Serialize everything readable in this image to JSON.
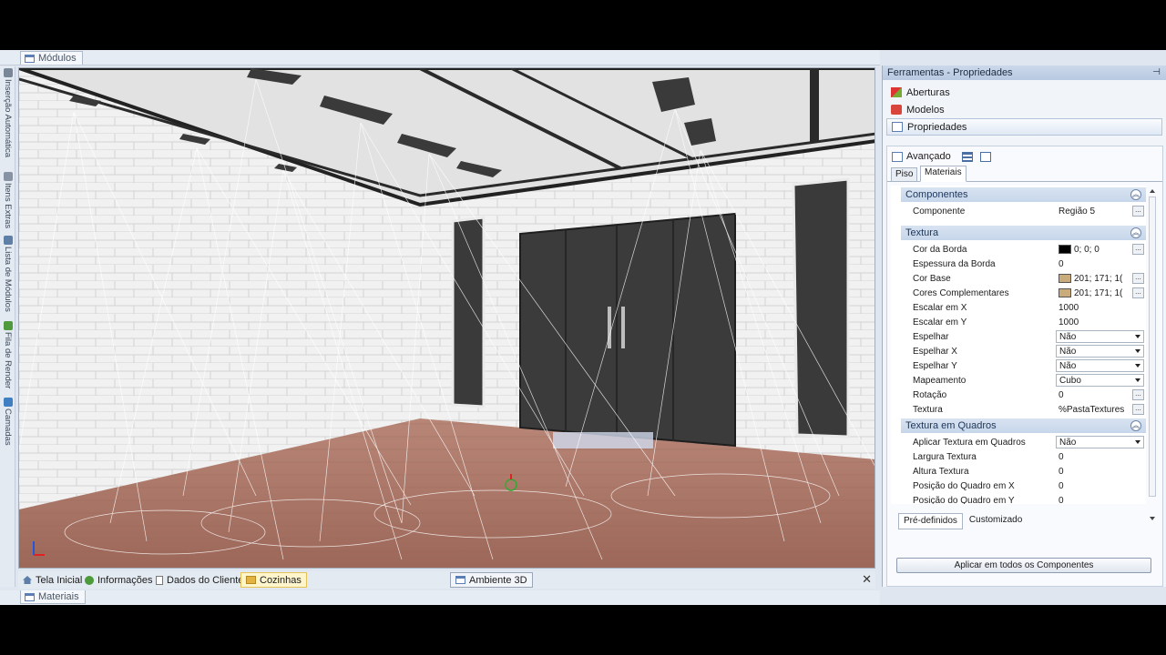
{
  "top_tab": {
    "label": "Módulos"
  },
  "bottom_tab": {
    "label": "Materiais"
  },
  "left_tabs": [
    {
      "label": "Inserção Automática"
    },
    {
      "label": "Itens Extras"
    },
    {
      "label": "Lista de Módulos"
    },
    {
      "label": "Fila de Render"
    },
    {
      "label": "Camadas"
    }
  ],
  "document_tabs": [
    {
      "label": "Tela Inicial",
      "icon": "home-icon"
    },
    {
      "label": "Informações",
      "icon": "info-icon"
    },
    {
      "label": "Dados do Cliente",
      "icon": "document-icon"
    },
    {
      "label": "Cozinhas",
      "icon": "folder-icon"
    },
    {
      "label": "Ambiente 3D",
      "icon": "window-icon"
    }
  ],
  "close_glyph": "✕",
  "panel": {
    "title": "Ferramentas - Propriedades",
    "pin_glyph": "⊣",
    "accordion": [
      {
        "label": "Aberturas",
        "icon": "door-icon"
      },
      {
        "label": "Modelos",
        "icon": "models-icon"
      },
      {
        "label": "Propriedades",
        "icon": "properties-icon"
      }
    ],
    "sub_title": "Avançado",
    "prop_tabs": [
      "Piso",
      "Materiais"
    ],
    "categories": [
      {
        "title": "Componentes",
        "rows": [
          {
            "key": "Componente",
            "value": "Região 5",
            "kind": "dots"
          }
        ]
      },
      {
        "title": "Textura",
        "rows": [
          {
            "key": "Cor da Borda",
            "value": "0; 0; 0",
            "kind": "color",
            "color": "#000000"
          },
          {
            "key": "Espessura da Borda",
            "value": "0",
            "kind": "text"
          },
          {
            "key": "Cor Base",
            "value": "201; 171; 1(",
            "kind": "color",
            "color": "#c9ab7c"
          },
          {
            "key": "Cores Complementares",
            "value": "201; 171; 1(",
            "kind": "color",
            "color": "#c9ab7c"
          },
          {
            "key": "Escalar em X",
            "value": "1000",
            "kind": "text"
          },
          {
            "key": "Escalar em Y",
            "value": "1000",
            "kind": "text"
          },
          {
            "key": "Espelhar",
            "value": "Não",
            "kind": "combo"
          },
          {
            "key": "Espelhar X",
            "value": "Não",
            "kind": "combo"
          },
          {
            "key": "Espelhar Y",
            "value": "Não",
            "kind": "combo"
          },
          {
            "key": "Mapeamento",
            "value": "Cubo",
            "kind": "combo"
          },
          {
            "key": "Rotação",
            "value": "0",
            "kind": "dots"
          },
          {
            "key": "Textura",
            "value": "%PastaTextures",
            "kind": "dots"
          }
        ]
      },
      {
        "title": "Textura em Quadros",
        "rows": [
          {
            "key": "Aplicar Textura em Quadros",
            "value": "Não",
            "kind": "combo"
          },
          {
            "key": "Largura Textura",
            "value": "0",
            "kind": "text"
          },
          {
            "key": "Altura Textura",
            "value": "0",
            "kind": "text"
          },
          {
            "key": "Posição do Quadro em X",
            "value": "0",
            "kind": "text"
          },
          {
            "key": "Posição do Quadro em Y",
            "value": "0",
            "kind": "text"
          }
        ]
      }
    ],
    "bottom_tabs": [
      "Pré-definidos",
      "Customizado"
    ],
    "apply_button": "Aplicar em todos os Componentes",
    "dots_glyph": "...",
    "collapse_glyph": "︽"
  }
}
